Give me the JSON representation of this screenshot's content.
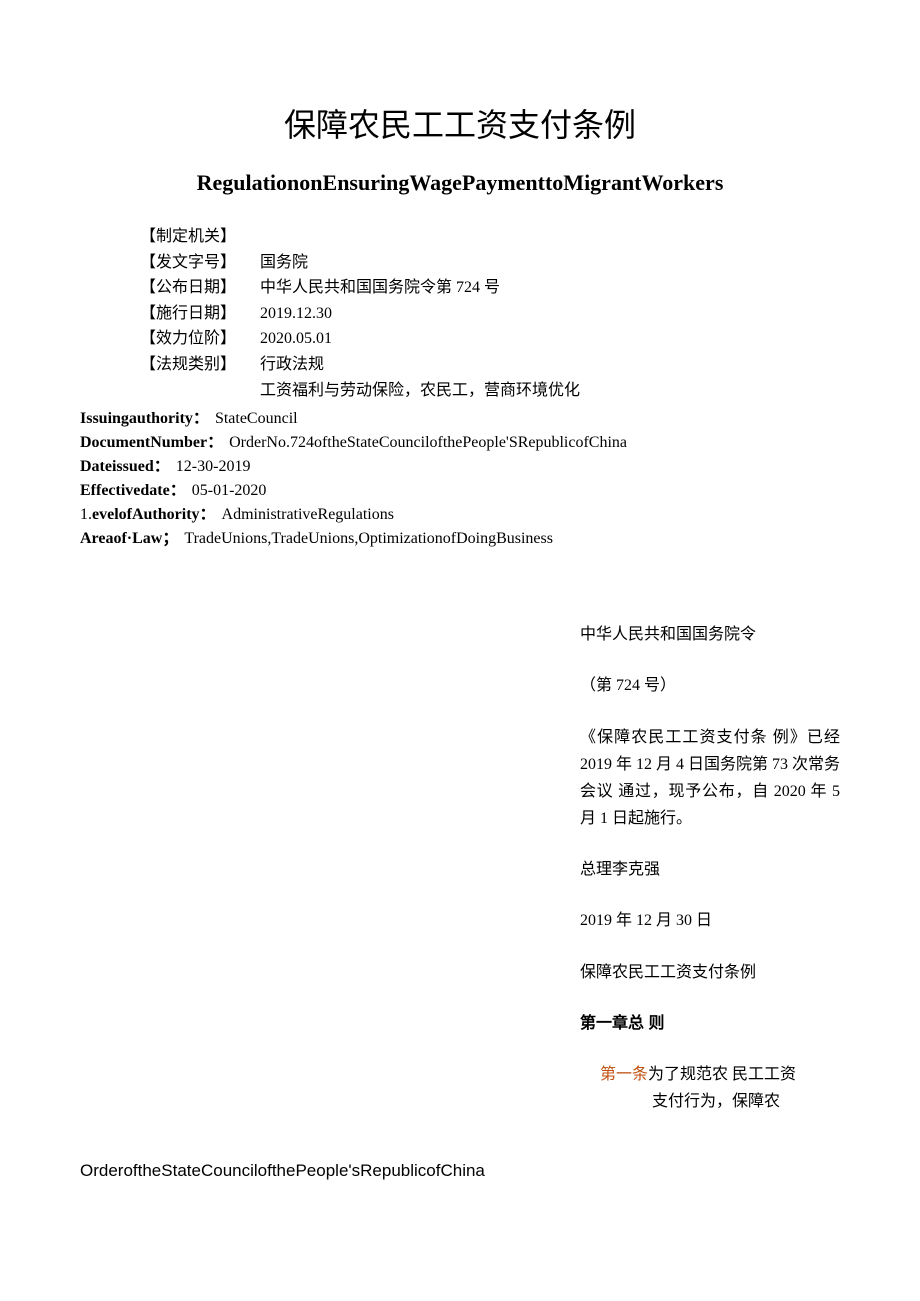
{
  "title_cn": "保障农民工工资支付条例",
  "title_en": "RegulationonEnsuringWagePaymenttoMigrantWorkers",
  "meta_cn": {
    "labels": [
      "【制定机关】",
      "【发文字号】",
      "【公布日期】",
      "【施行日期】",
      "【效力位阶】",
      "【法规类别】"
    ],
    "values": [
      "国务院",
      "中华人民共和国国务院令第 724 号",
      "2019.12.30",
      "2020.05.01",
      "行政法规",
      "工资福利与劳动保险，农民工，营商环境优化"
    ]
  },
  "meta_en": {
    "rows": [
      {
        "label": "Issuingauthority：",
        "value": "StateCouncil"
      },
      {
        "label": "DocumentNumber：",
        "value": "OrderNo.724oftheStateCouncilofthePeople'SRepublicofChina"
      },
      {
        "label": "Dateissued：",
        "value": "12-30-2019"
      },
      {
        "label": "Effectivedate：",
        "value": "05-01-2020"
      },
      {
        "label": "1.evelofAuthority：",
        "value": "AdministrativeRegulations",
        "prefix_bold": false
      },
      {
        "label": "Areaof·Law；",
        "value": "TradeUnions,TradeUnions,OptimizationofDoingBusiness"
      }
    ]
  },
  "body": {
    "order_title": "中华人民共和国国务院令",
    "order_number": "（第 724 号）",
    "announcement": "《保障农民工工资支付条  例》已经 2019 年 12 月 4 日国务院第 73 次常务会议 通过，现予公布，自 2020 年 5 月 1 日起施行。",
    "signature_name": "总理李克强",
    "signature_date": "2019 年 12 月 30 日",
    "regulation_title": "保障农民工工资支付条例",
    "chapter_1": "第一章总  则",
    "article_1_label": "第一条",
    "article_1_text_a": "为了规范农  民工工资",
    "article_1_text_b": "支付行为，保障农"
  },
  "left_bottom": "OrderoftheStateCouncilofthePeople'sRepublicofChina"
}
